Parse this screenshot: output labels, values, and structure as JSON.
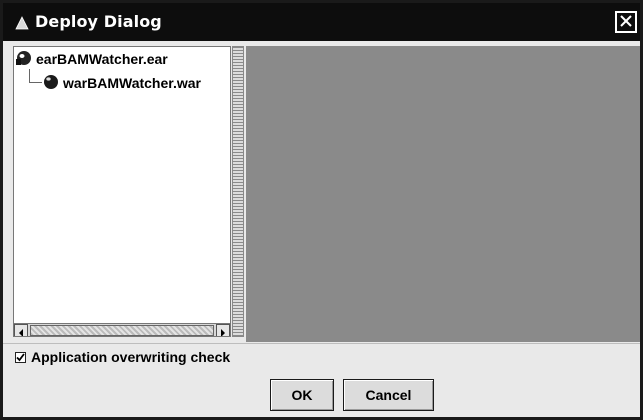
{
  "window": {
    "title": "Deploy Dialog",
    "title_icon": "triangle-app-icon",
    "close_icon": "close-x-icon"
  },
  "tree": {
    "items": [
      {
        "label": "earBAMWatcher.ear",
        "icon": "ear-archive-icon",
        "level": 0
      },
      {
        "label": "warBAMWatcher.war",
        "icon": "war-module-icon",
        "level": 1
      }
    ]
  },
  "options": {
    "overwrite_check_label": "Application overwriting check",
    "overwrite_checked": true
  },
  "buttons": {
    "ok_label": "OK",
    "cancel_label": "Cancel"
  },
  "colors": {
    "titlebar": "#0d0d0d",
    "detail_panel": "#8a8a8a",
    "dialog_background": "#e9e9e9"
  }
}
